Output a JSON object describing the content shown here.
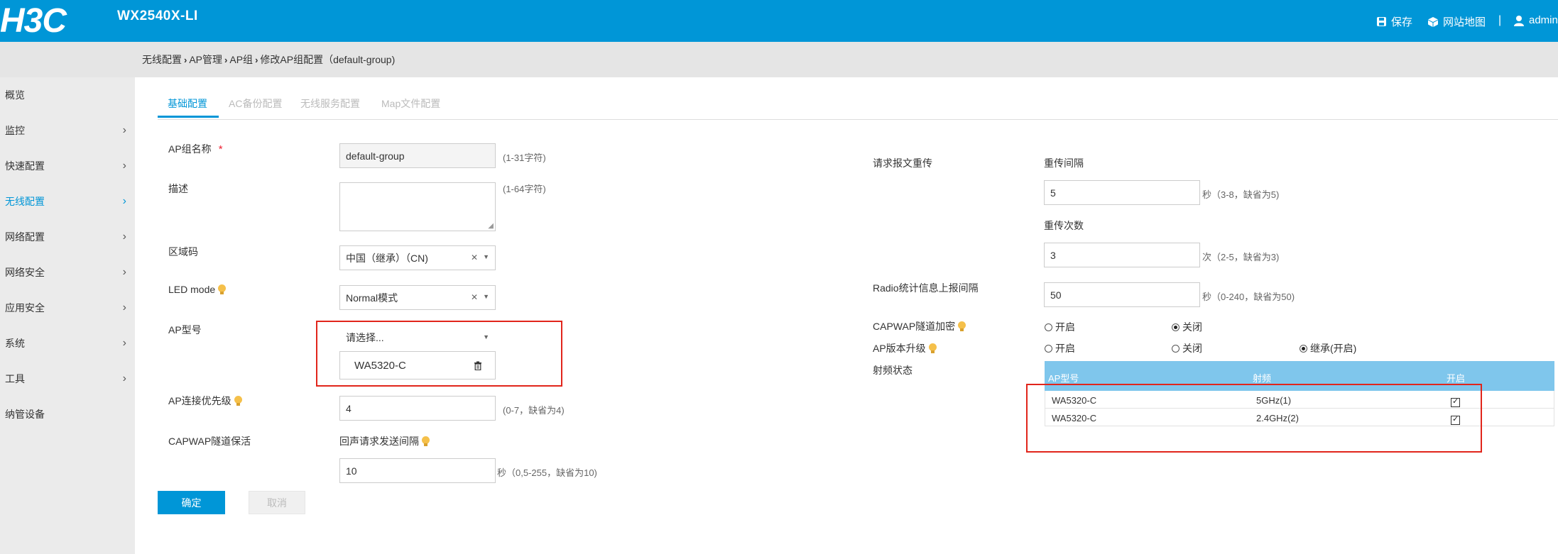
{
  "header": {
    "logo_text": "H3C",
    "device": "WX2540X-LI",
    "save": "保存",
    "sitemap": "网站地图",
    "separator": "|",
    "user": "admin"
  },
  "breadcrumb": [
    "无线配置",
    "AP管理",
    "AP组",
    "修改AP组配置（default-group)"
  ],
  "sidebar": {
    "items": [
      {
        "label": "概览"
      },
      {
        "label": "监控",
        "chevron": "›"
      },
      {
        "label": "快速配置",
        "chevron": "›"
      },
      {
        "label": "无线配置",
        "chevron": "›"
      },
      {
        "label": "网络配置",
        "chevron": "›"
      },
      {
        "label": "网络安全",
        "chevron": "›"
      },
      {
        "label": "应用安全",
        "chevron": "›"
      },
      {
        "label": "系统",
        "chevron": "›"
      },
      {
        "label": "工具",
        "chevron": "›"
      },
      {
        "label": "纳管设备"
      }
    ]
  },
  "tabs": [
    "基础配置",
    "AC备份配置",
    "无线服务配置",
    "Map文件配置"
  ],
  "form": {
    "group_name": {
      "label": "AP组名称",
      "required": "*",
      "value": "default-group",
      "hint": "(1-31字符)"
    },
    "description": {
      "label": "描述",
      "hint": "(1-64字符)"
    },
    "region": {
      "label": "区域码",
      "value": "中国（继承）（CN)"
    },
    "led": {
      "label": "LED mode",
      "value": "Normal模式"
    },
    "ap_model": {
      "label": "AP型号",
      "placeholder": "请选择...",
      "selected": "WA5320-C"
    },
    "priority": {
      "label": "AP连接优先级",
      "value": "4",
      "hint": "(0-7，缺省为4)"
    },
    "keepalive": {
      "label": "CAPWAP隧道保活",
      "sub_label": "回声请求发送间隔",
      "value": "10",
      "hint": "秒（0,5-255，缺省为10)"
    }
  },
  "right": {
    "retransmit_label": "请求报文重传",
    "interval_label": "重传间隔",
    "interval_value": "5",
    "interval_hint": "秒（3-8，缺省为5)",
    "count_label": "重传次数",
    "count_value": "3",
    "count_hint": "次（2-5，缺省为3)",
    "radio_stat_label": "Radio统计信息上报间隔",
    "radio_stat_value": "50",
    "radio_stat_hint": "秒（0-240，缺省为50)",
    "capwap_encrypt_label": "CAPWAP隧道加密",
    "encrypt_on": "开启",
    "encrypt_off": "关闭",
    "upgrade_label": "AP版本升级",
    "upgrade_on": "开启",
    "upgrade_off": "关闭",
    "upgrade_inherit": "继承(开启)",
    "rf_label": "射频状态"
  },
  "rf_table": {
    "headers": [
      "AP型号",
      "射频",
      "开启"
    ],
    "rows": [
      {
        "model": "WA5320-C",
        "radio": "5GHz(1)",
        "enabled": true
      },
      {
        "model": "WA5320-C",
        "radio": "2.4GHz(2)",
        "enabled": true
      }
    ]
  },
  "buttons": {
    "confirm": "确定",
    "cancel": "取消"
  },
  "colors": {
    "brand": "#0096d7",
    "highlight": "#e1251b"
  }
}
